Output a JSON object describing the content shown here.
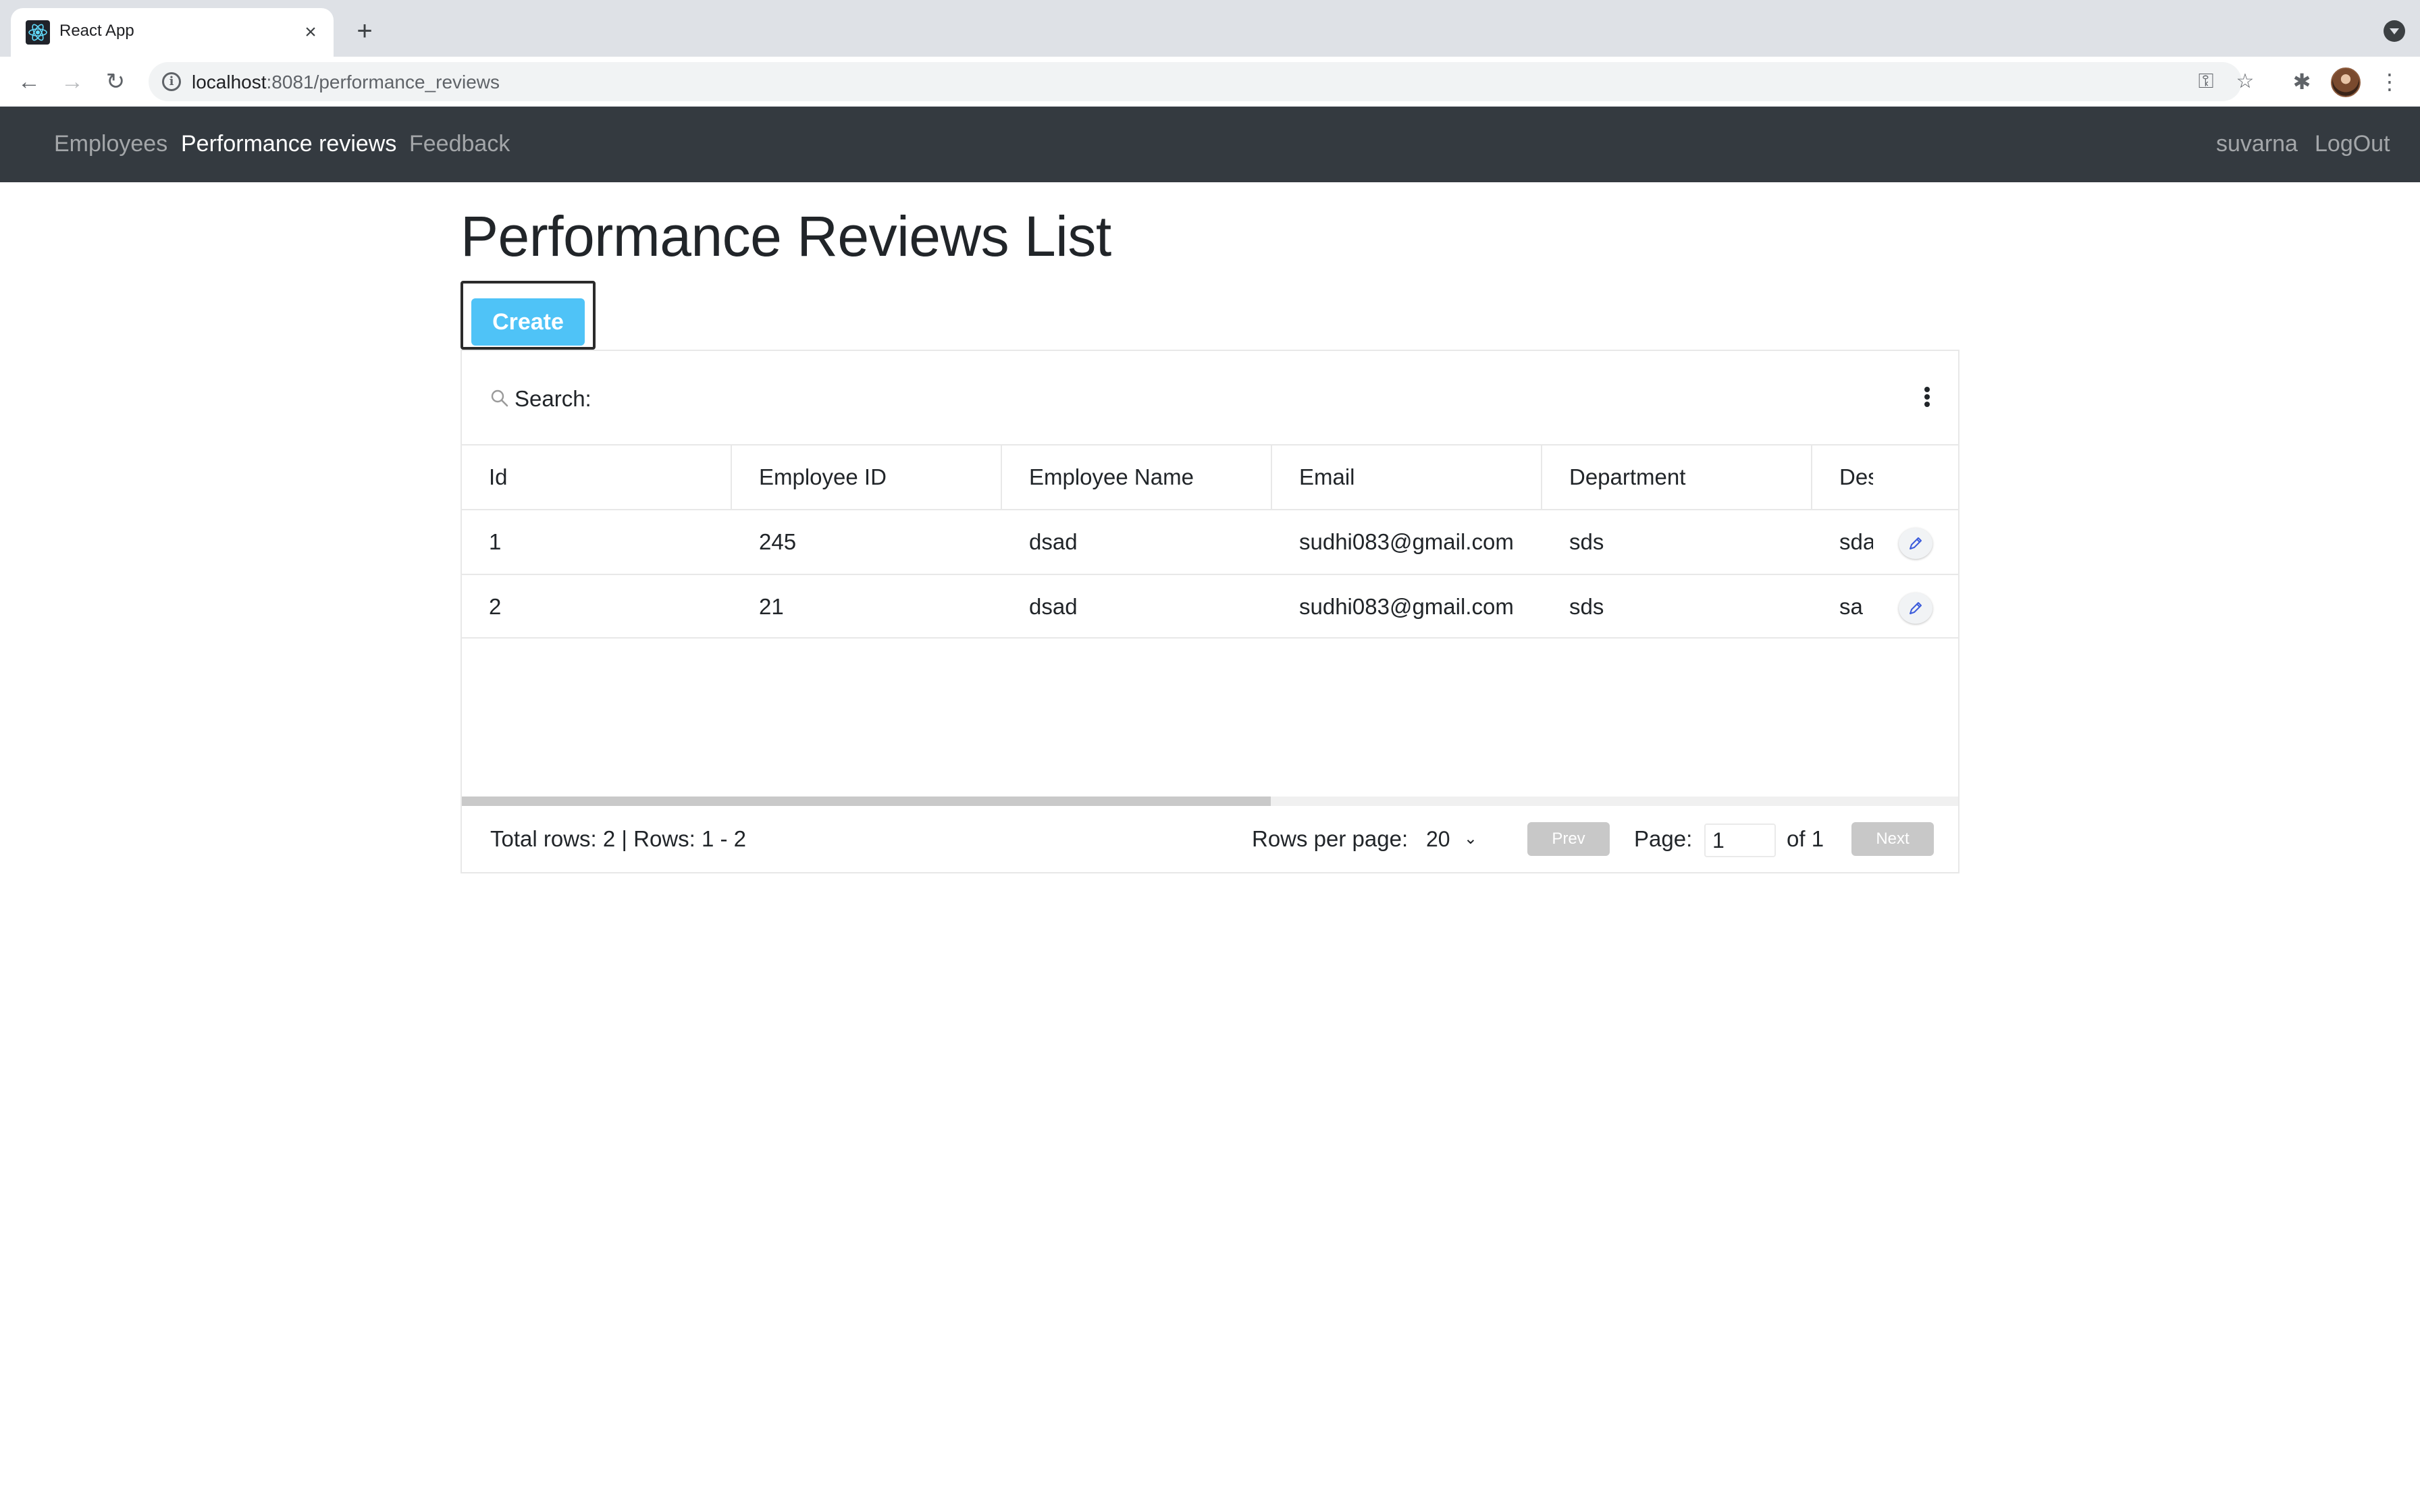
{
  "browser": {
    "tab_title": "React App",
    "url_host": "localhost",
    "url_rest": ":8081/performance_reviews"
  },
  "navbar": {
    "links": [
      "Employees",
      "Performance reviews",
      "Feedback"
    ],
    "active": "Performance reviews",
    "user": "suvarna",
    "logout": "LogOut"
  },
  "page": {
    "title": "Performance Reviews List",
    "create_label": "Create"
  },
  "table": {
    "search_label": "Search:",
    "columns": [
      "Id",
      "Employee ID",
      "Employee Name",
      "Email",
      "Department",
      "Des"
    ],
    "rows": [
      [
        "1",
        "245",
        "dsad",
        "sudhi083@gmail.com",
        "sds",
        "sda"
      ],
      [
        "2",
        "21",
        "dsad",
        "sudhi083@gmail.com",
        "sds",
        "sa"
      ]
    ],
    "horizontal_scroll_fraction_visible": 0.54
  },
  "footer": {
    "total_text": "Total rows: 2 | Rows: 1 - 2",
    "rows_per_page_label": "Rows per page:",
    "rows_per_page_value": "20",
    "prev_label": "Prev",
    "page_label": "Page:",
    "page_value": "1",
    "of_text": "of 1",
    "next_label": "Next"
  },
  "colors": {
    "navbar_bg": "#343a40",
    "create_button": "#4fc3f7",
    "pager_disabled": "#c8c8c8"
  }
}
